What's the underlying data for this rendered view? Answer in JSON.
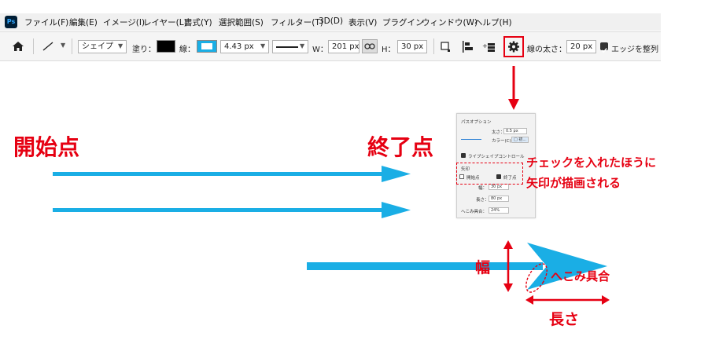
{
  "app": {
    "logo": "Ps"
  },
  "menu": [
    "ファイル(F)",
    "編集(E)",
    "イメージ(I)",
    "レイヤー(L)",
    "書式(Y)",
    "選択範囲(S)",
    "フィルター(T)",
    "3D(D)",
    "表示(V)",
    "プラグイン",
    "ウィンドウ(W)",
    "ヘルプ(H)"
  ],
  "options": {
    "home_icon": "home-icon",
    "tool_icon": "line-tool-icon",
    "mode": "シェイプ",
    "fill_label": "塗り：",
    "stroke_label": "線：",
    "stroke_width": "4.43 px",
    "w_label": "W：",
    "w_value": "201 px",
    "h_label": "H：",
    "h_value": "30 px",
    "line_weight_label": "線の太さ：",
    "line_weight_value": "20 px",
    "align_edges_label": "エッジを整列",
    "align_edges_checked": true,
    "fill_color": "#000000",
    "stroke_color": "#1aaee5"
  },
  "panel": {
    "title": "パスオプション",
    "weight_label": "太さ：",
    "weight_value": "0.5 px",
    "color_label": "カラー(C)：",
    "color_value": "□ 初...",
    "live_shape_label": "ライブシェイプコントロール",
    "live_shape_checked": true,
    "arrow_section_label": "矢印",
    "start_label": "開始点",
    "start_checked": false,
    "end_label": "終了点",
    "end_checked": true,
    "width_label": "幅：",
    "width_value": "30 px",
    "length_label": "長さ：",
    "length_value": "80 px",
    "concavity_label": "へこみ具合：",
    "concavity_value": "24%"
  },
  "annotations": {
    "start_point": "開始点",
    "end_point": "終了点",
    "note_line1": "チェックを入れたほうに",
    "note_line2": "矢印が描画される",
    "width": "幅",
    "concavity": "へこみ具合",
    "length": "長さ"
  },
  "colors": {
    "accent_red": "#e60012",
    "arrow_blue": "#1aaee5"
  }
}
